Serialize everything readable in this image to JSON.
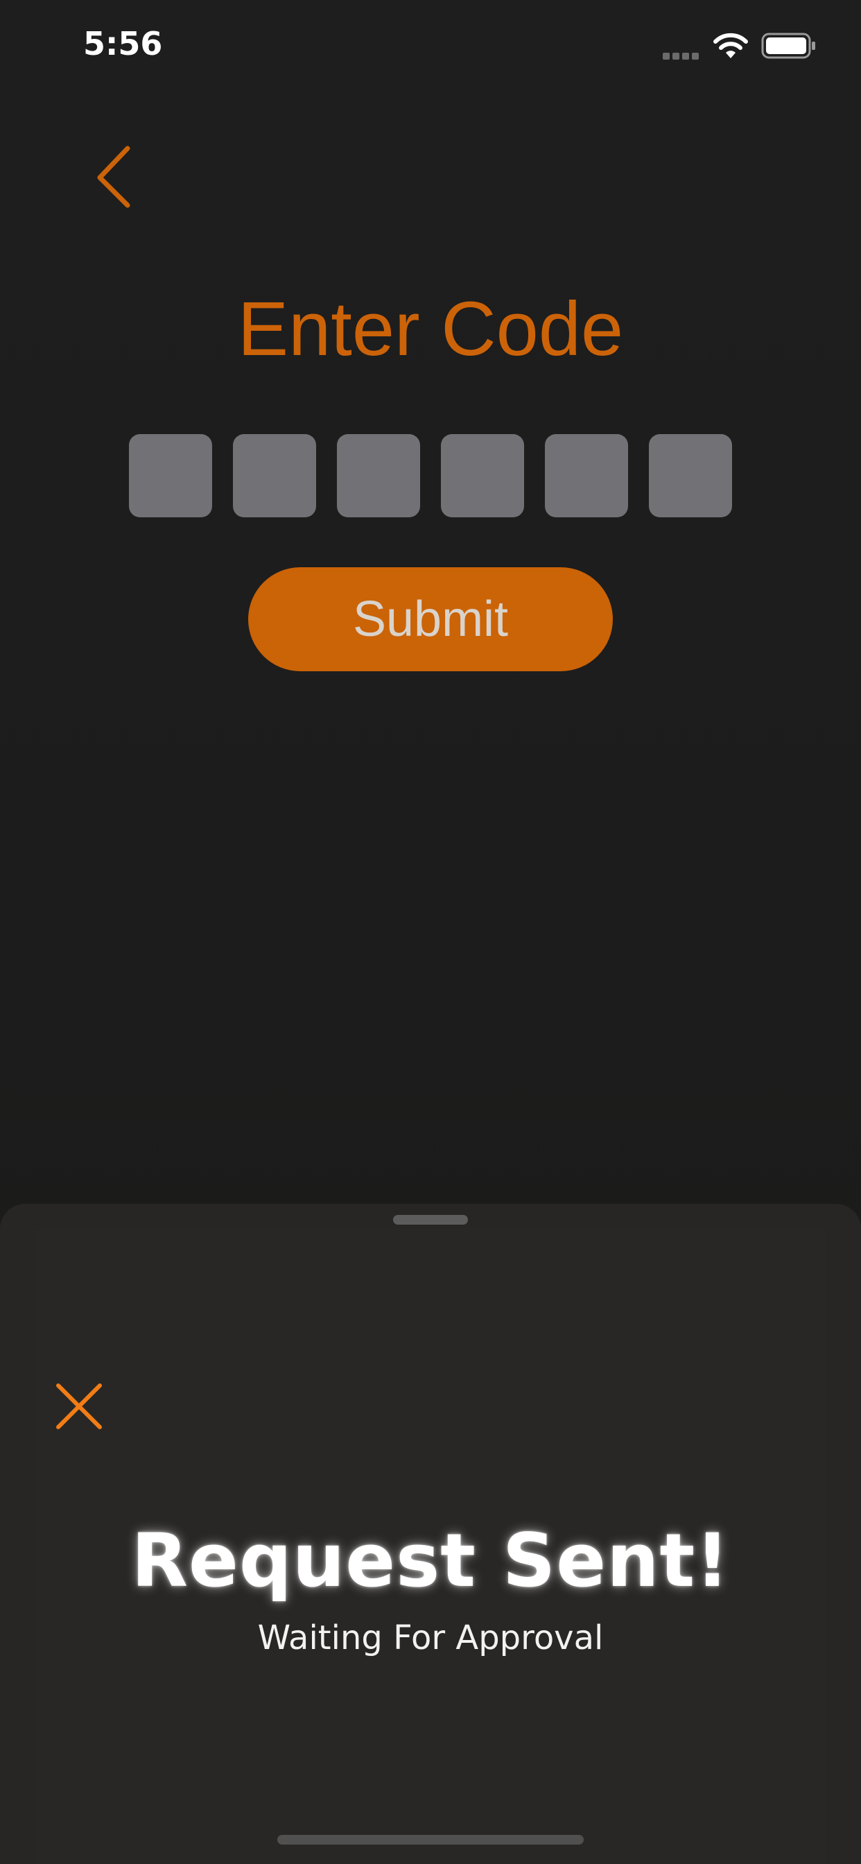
{
  "status_bar": {
    "time": "5:56",
    "signal_icon": "cellular-signal-icon",
    "wifi_icon": "wifi-icon",
    "battery_icon": "battery-full-icon"
  },
  "nav": {
    "back_icon": "chevron-left-icon"
  },
  "main": {
    "title": "Enter Code",
    "code_digits": [
      "",
      "",
      "",
      "",
      "",
      ""
    ],
    "submit_label": "Submit"
  },
  "sheet": {
    "close_icon": "close-x-icon",
    "title": "Request Sent!",
    "subtitle": "Waiting For Approval"
  },
  "colors": {
    "accent": "#cc6309",
    "close_accent": "#f27d16",
    "background": "#1d1d1d",
    "sheet_background": "#272624",
    "code_box": "#727276"
  }
}
